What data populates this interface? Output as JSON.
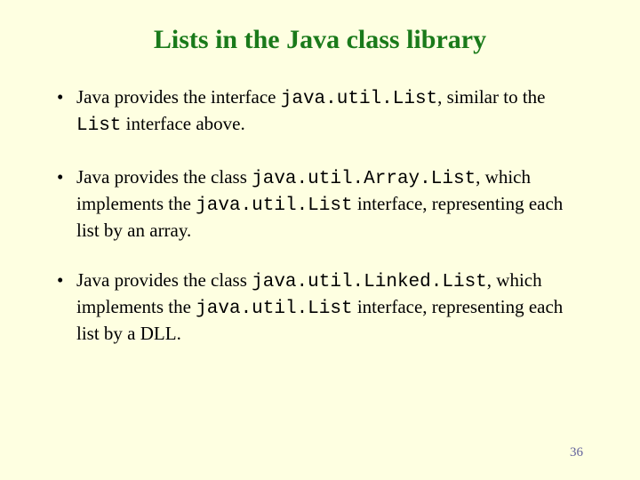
{
  "title": "Lists in the Java class library",
  "bullets": [
    {
      "pre1": "Java provides the interface ",
      "code1": "java.util.List",
      "mid1": ", similar to the ",
      "code2": "List",
      "post1": " interface above."
    },
    {
      "pre1": "Java provides the class ",
      "code1": "java.util.Array.List",
      "mid1": ", which implements the ",
      "code2": "java.util.List",
      "post1": " interface, representing each list by an array."
    },
    {
      "pre1": "Java provides the class ",
      "code1": "java.util.Linked.List",
      "mid1": ", which implements the ",
      "code2": "java.util.List",
      "post1": " interface, representing each list by a DLL."
    }
  ],
  "page_number": "36"
}
